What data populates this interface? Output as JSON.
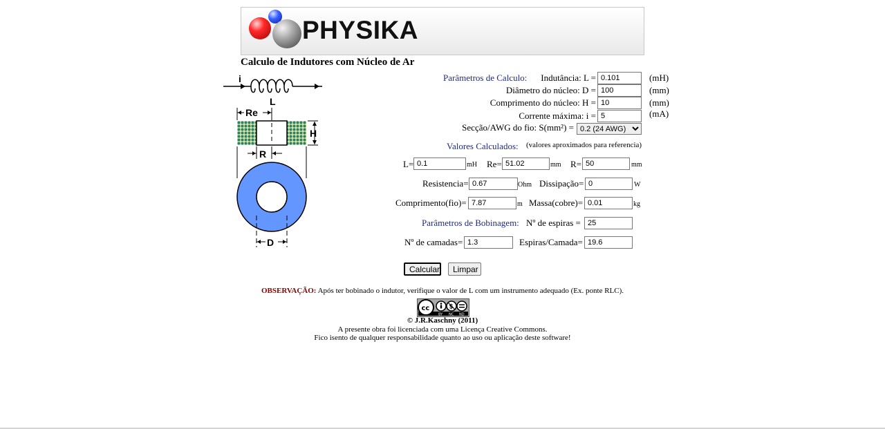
{
  "banner": {
    "logo_text": "PHYSIKA"
  },
  "page_title": "Calculo de Indutores com Núcleo de Ar",
  "diagram": {
    "i": "i",
    "L": "L",
    "Re": "Re",
    "H": "H",
    "R": "R",
    "D": "D"
  },
  "params": {
    "header": "Parâmetros de Calculo:",
    "L_label": "Indutância: L =",
    "L_value": "0.101",
    "L_unit": "(mH)",
    "D_label": "Diâmetro do núcleo: D =",
    "D_value": "100",
    "D_unit": "(mm)",
    "H_label": "Comprimento do núcleo: H =",
    "H_value": "10",
    "H_unit": "(mm)",
    "i_label": "Corrente máxima: i =",
    "i_value": "5",
    "i_unit": "(mA)",
    "wire_label": "Secção/AWG do fio: S(mm²) =",
    "wire_selected": "0.2 (24 AWG)"
  },
  "computed": {
    "header": "Valores Calculados:",
    "note": "(valores aproximados para referencia)",
    "L_label": "L=",
    "L_value": "0.1",
    "L_unit": "mH",
    "Re_label": "Re=",
    "Re_value": "51.02",
    "Re_unit": "mm",
    "R_label": "R=",
    "R_value": "50",
    "R_unit": "mm",
    "res_label": "Resistencia=",
    "res_value": "0.67",
    "res_unit": "Ohm",
    "diss_label": "Dissipação=",
    "diss_value": "0",
    "diss_unit": "W",
    "len_label": "Comprimento(fio)=",
    "len_value": "7.87",
    "len_unit": "m",
    "mass_label": "Massa(cobre)=",
    "mass_value": "0.01",
    "mass_unit": "kg"
  },
  "winding": {
    "header": "Parâmetros de Bobinagem:",
    "turns_label": "Nº de espiras =",
    "turns_value": "25",
    "layers_label": "Nº de camadas=",
    "layers_value": "1.3",
    "per_layer_label": "Espiras/Camada=",
    "per_layer_value": "19.6"
  },
  "buttons": {
    "calc": "Calcular",
    "clear": "Limpar"
  },
  "footer": {
    "obs_label": "OBSERVAÇÃO:",
    "obs_text": " Após ter bobinado o indutor, verifique o valor de L com um instrumento adequado (Ex. ponte RLC).",
    "license_badge": "cc-by-nc-nd-badge",
    "copyright": "© J.R.Kaschny (2011)",
    "license_line": "A presente obra foi licenciada com uma Licença Creative Commons.",
    "disclaimer": "Fico isento de qualquer responsabilidade quanto ao uso ou aplicação deste software!"
  }
}
